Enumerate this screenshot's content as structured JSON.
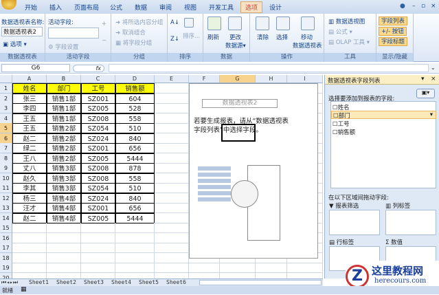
{
  "ribbon_tabs": [
    "开始",
    "插入",
    "页面布局",
    "公式",
    "数据",
    "审阅",
    "视图",
    "开发工具",
    "选项",
    "设计"
  ],
  "active_tab": "选项",
  "ribbon": {
    "pivot_name_label": "数据透视表名称:",
    "pivot_name_value": "数据透视表2",
    "options": "选项",
    "active_field_label": "活动字段:",
    "field_settings": "字段设置",
    "group_selection": "将所选内容分组",
    "ungroup": "取消组合",
    "group_field": "将字段分组",
    "sort": "排序...",
    "refresh": "刷新",
    "change_source": "更改",
    "change_source2": "数据源",
    "clear": "清除",
    "select": "选择",
    "move": "移动",
    "move2": "数据透视表",
    "pivot_chart": "数据透视图",
    "formulas": "公式",
    "olap": "OLAP 工具",
    "field_list": "字段列表",
    "buttons": "+/- 按钮",
    "headers": "字段标题",
    "groups": [
      "数据透视表",
      "活动字段",
      "分组",
      "排序",
      "数据",
      "操作",
      "工具",
      "显示/隐藏"
    ]
  },
  "formula_bar": {
    "name_box": "G6",
    "fx": "fx"
  },
  "columns": [
    "A",
    "B",
    "C",
    "D",
    "E",
    "F",
    "G",
    "H",
    "I"
  ],
  "table": {
    "headers": [
      "姓名",
      "部门",
      "工号",
      "销售额"
    ],
    "rows": [
      [
        "张三",
        "销售1部",
        "SZ001",
        "604"
      ],
      [
        "李四",
        "销售1部",
        "SZ005",
        "528"
      ],
      [
        "王五",
        "销售1部",
        "SZ008",
        "558"
      ],
      [
        "王五",
        "销售2部",
        "SZ054",
        "510"
      ],
      [
        "赵二",
        "销售2部",
        "SZ024",
        "840"
      ],
      [
        "绿二",
        "销售2部",
        "SZ001",
        "656"
      ],
      [
        "王八",
        "销售2部",
        "SZ005",
        "5444"
      ],
      [
        "丈八",
        "销售3部",
        "SZ008",
        "878"
      ],
      [
        "赵久",
        "销售3部",
        "SZ008",
        "558"
      ],
      [
        "李其",
        "销售3部",
        "SZ054",
        "510"
      ],
      [
        "杨三",
        "销售4部",
        "SZ024",
        "840"
      ],
      [
        "汪才",
        "销售4部",
        "SZ001",
        "656"
      ],
      [
        "赵二",
        "销售4部",
        "SZ005",
        "5444"
      ]
    ]
  },
  "row_numbers": [
    "1",
    "2",
    "3",
    "4",
    "5",
    "6",
    "7",
    "8",
    "9",
    "10",
    "11",
    "12",
    "13",
    "14",
    "15",
    "16",
    "17",
    "18",
    "19",
    "20"
  ],
  "pivot_placeholder": {
    "title": "数据透视表2",
    "hint": "若要生成报表，请从“数据透视表字段列表”中选择字段。"
  },
  "field_list": {
    "title": "数据透视表字段列表",
    "choose_label": "选择要添加到报表的字段:",
    "fields": [
      "姓名",
      "部门",
      "工号",
      "销售额"
    ],
    "drag_label": "在以下区域间拖动字段:",
    "report_filter": "报表筛选",
    "column_labels": "列标签",
    "row_labels": "行标签",
    "values": "数值"
  },
  "sheets": [
    "Sheet1",
    "Sheet2",
    "Sheet3",
    "Sheet4",
    "Sheet5",
    "Sheet6"
  ],
  "status": "就绪",
  "watermark": {
    "title": "这里教程网",
    "url": "herecours.com"
  }
}
